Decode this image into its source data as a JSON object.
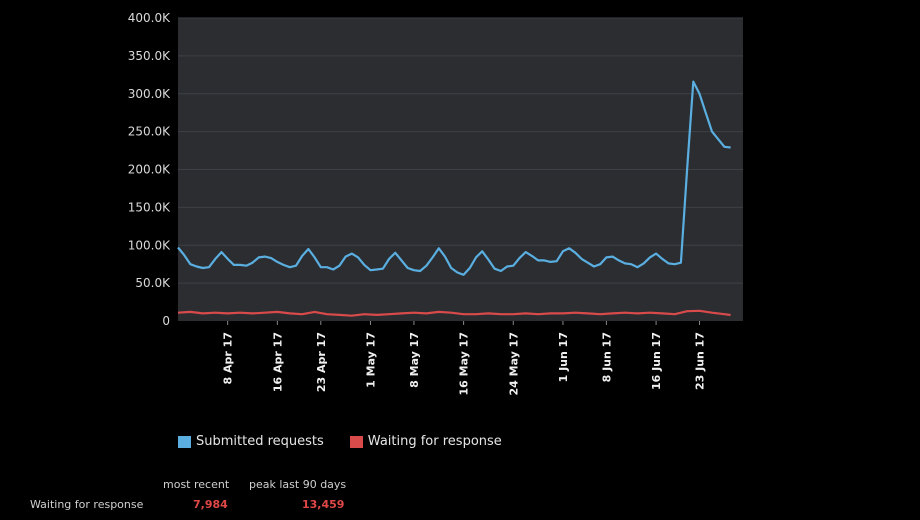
{
  "chart_data": {
    "type": "line",
    "ylim": [
      0,
      400000
    ],
    "y_ticks": [
      {
        "value": 0,
        "label": "0"
      },
      {
        "value": 50000,
        "label": "50.0K"
      },
      {
        "value": 100000,
        "label": "100.0K"
      },
      {
        "value": 150000,
        "label": "150.0K"
      },
      {
        "value": 200000,
        "label": "200.0K"
      },
      {
        "value": 250000,
        "label": "250.0K"
      },
      {
        "value": 300000,
        "label": "300.0K"
      },
      {
        "value": 350000,
        "label": "350.0K"
      },
      {
        "value": 400000,
        "label": "400.0K"
      }
    ],
    "x_range": [
      "2017-03-31",
      "2017-06-30"
    ],
    "x_ticks": [
      {
        "date": "2017-04-08",
        "label": "8 Apr 17"
      },
      {
        "date": "2017-04-16",
        "label": "16 Apr 17"
      },
      {
        "date": "2017-04-23",
        "label": "23 Apr 17"
      },
      {
        "date": "2017-05-01",
        "label": "1 May 17"
      },
      {
        "date": "2017-05-08",
        "label": "8 May 17"
      },
      {
        "date": "2017-05-16",
        "label": "16 May 17"
      },
      {
        "date": "2017-05-24",
        "label": "24 May 17"
      },
      {
        "date": "2017-06-01",
        "label": "1 Jun 17"
      },
      {
        "date": "2017-06-08",
        "label": "8 Jun 17"
      },
      {
        "date": "2017-06-16",
        "label": "16 Jun 17"
      },
      {
        "date": "2017-06-23",
        "label": "23 Jun 17"
      }
    ],
    "grid": true,
    "legend_position": "bottom-left",
    "series": [
      {
        "name": "Submitted requests",
        "color": "#5aaee0",
        "points": [
          [
            "2017-03-31",
            97000
          ],
          [
            "2017-04-01",
            87000
          ],
          [
            "2017-04-02",
            75000
          ],
          [
            "2017-04-03",
            72000
          ],
          [
            "2017-04-04",
            70000
          ],
          [
            "2017-04-05",
            71000
          ],
          [
            "2017-04-06",
            82000
          ],
          [
            "2017-04-07",
            91000
          ],
          [
            "2017-04-08",
            82000
          ],
          [
            "2017-04-09",
            74000
          ],
          [
            "2017-04-10",
            74000
          ],
          [
            "2017-04-11",
            73000
          ],
          [
            "2017-04-12",
            77000
          ],
          [
            "2017-04-13",
            84000
          ],
          [
            "2017-04-14",
            85000
          ],
          [
            "2017-04-15",
            83000
          ],
          [
            "2017-04-16",
            78000
          ],
          [
            "2017-04-17",
            74000
          ],
          [
            "2017-04-18",
            71000
          ],
          [
            "2017-04-19",
            73000
          ],
          [
            "2017-04-20",
            86000
          ],
          [
            "2017-04-21",
            95000
          ],
          [
            "2017-04-22",
            84000
          ],
          [
            "2017-04-23",
            71000
          ],
          [
            "2017-04-24",
            71000
          ],
          [
            "2017-04-25",
            68000
          ],
          [
            "2017-04-26",
            73000
          ],
          [
            "2017-04-27",
            85000
          ],
          [
            "2017-04-28",
            89000
          ],
          [
            "2017-04-29",
            84000
          ],
          [
            "2017-04-30",
            74000
          ],
          [
            "2017-05-01",
            67000
          ],
          [
            "2017-05-02",
            68000
          ],
          [
            "2017-05-03",
            69000
          ],
          [
            "2017-05-04",
            82000
          ],
          [
            "2017-05-05",
            90000
          ],
          [
            "2017-05-06",
            80000
          ],
          [
            "2017-05-07",
            70000
          ],
          [
            "2017-05-08",
            67000
          ],
          [
            "2017-05-09",
            66000
          ],
          [
            "2017-05-10",
            73000
          ],
          [
            "2017-05-11",
            84000
          ],
          [
            "2017-05-12",
            96000
          ],
          [
            "2017-05-13",
            85000
          ],
          [
            "2017-05-14",
            70000
          ],
          [
            "2017-05-15",
            64000
          ],
          [
            "2017-05-16",
            61000
          ],
          [
            "2017-05-17",
            70000
          ],
          [
            "2017-05-18",
            84000
          ],
          [
            "2017-05-19",
            92000
          ],
          [
            "2017-05-20",
            81000
          ],
          [
            "2017-05-21",
            69000
          ],
          [
            "2017-05-22",
            66000
          ],
          [
            "2017-05-23",
            72000
          ],
          [
            "2017-05-24",
            73000
          ],
          [
            "2017-05-25",
            83000
          ],
          [
            "2017-05-26",
            91000
          ],
          [
            "2017-05-27",
            86000
          ],
          [
            "2017-05-28",
            80000
          ],
          [
            "2017-05-29",
            80000
          ],
          [
            "2017-05-30",
            78000
          ],
          [
            "2017-05-31",
            79000
          ],
          [
            "2017-06-01",
            92000
          ],
          [
            "2017-06-02",
            96000
          ],
          [
            "2017-06-03",
            90000
          ],
          [
            "2017-06-04",
            82000
          ],
          [
            "2017-06-05",
            77000
          ],
          [
            "2017-06-06",
            72000
          ],
          [
            "2017-06-07",
            75000
          ],
          [
            "2017-06-08",
            84000
          ],
          [
            "2017-06-09",
            85000
          ],
          [
            "2017-06-10",
            80000
          ],
          [
            "2017-06-11",
            76000
          ],
          [
            "2017-06-12",
            75000
          ],
          [
            "2017-06-13",
            71000
          ],
          [
            "2017-06-14",
            76000
          ],
          [
            "2017-06-15",
            84000
          ],
          [
            "2017-06-16",
            89000
          ],
          [
            "2017-06-17",
            82000
          ],
          [
            "2017-06-18",
            76000
          ],
          [
            "2017-06-19",
            75000
          ],
          [
            "2017-06-20",
            77000
          ],
          [
            "2017-06-21",
            200000
          ],
          [
            "2017-06-22",
            316000
          ],
          [
            "2017-06-23",
            300000
          ],
          [
            "2017-06-24",
            275000
          ],
          [
            "2017-06-25",
            250000
          ],
          [
            "2017-06-26",
            240000
          ],
          [
            "2017-06-27",
            230000
          ],
          [
            "2017-06-28",
            229000
          ]
        ]
      },
      {
        "name": "Waiting for response",
        "color": "#d94a4a",
        "points": [
          [
            "2017-03-31",
            11000
          ],
          [
            "2017-04-02",
            12000
          ],
          [
            "2017-04-04",
            10000
          ],
          [
            "2017-04-06",
            11000
          ],
          [
            "2017-04-08",
            10000
          ],
          [
            "2017-04-10",
            11000
          ],
          [
            "2017-04-12",
            10000
          ],
          [
            "2017-04-14",
            11000
          ],
          [
            "2017-04-16",
            12000
          ],
          [
            "2017-04-18",
            10000
          ],
          [
            "2017-04-20",
            9000
          ],
          [
            "2017-04-22",
            12000
          ],
          [
            "2017-04-24",
            9000
          ],
          [
            "2017-04-26",
            8000
          ],
          [
            "2017-04-28",
            7000
          ],
          [
            "2017-04-30",
            9000
          ],
          [
            "2017-05-02",
            8000
          ],
          [
            "2017-05-04",
            9000
          ],
          [
            "2017-05-06",
            10000
          ],
          [
            "2017-05-08",
            11000
          ],
          [
            "2017-05-10",
            10000
          ],
          [
            "2017-05-12",
            12000
          ],
          [
            "2017-05-14",
            11000
          ],
          [
            "2017-05-16",
            9000
          ],
          [
            "2017-05-18",
            9000
          ],
          [
            "2017-05-20",
            10000
          ],
          [
            "2017-05-22",
            9000
          ],
          [
            "2017-05-24",
            9000
          ],
          [
            "2017-05-26",
            10000
          ],
          [
            "2017-05-28",
            9000
          ],
          [
            "2017-05-30",
            10000
          ],
          [
            "2017-06-01",
            10000
          ],
          [
            "2017-06-03",
            11000
          ],
          [
            "2017-06-05",
            10000
          ],
          [
            "2017-06-07",
            9000
          ],
          [
            "2017-06-09",
            10000
          ],
          [
            "2017-06-11",
            11000
          ],
          [
            "2017-06-13",
            10000
          ],
          [
            "2017-06-15",
            11000
          ],
          [
            "2017-06-17",
            10000
          ],
          [
            "2017-06-19",
            9000
          ],
          [
            "2017-06-21",
            13000
          ],
          [
            "2017-06-23",
            13459
          ],
          [
            "2017-06-25",
            11000
          ],
          [
            "2017-06-27",
            9000
          ],
          [
            "2017-06-28",
            7984
          ]
        ]
      }
    ]
  },
  "summary": {
    "col_recent": "most recent",
    "col_peak": "peak last 90 days",
    "row_label": "Waiting for response",
    "recent_value": "7,984",
    "peak_value": "13,459"
  },
  "colors": {
    "plot_bg": "#2b2d31",
    "grid": "#3d4046",
    "value_red": "#e04848"
  }
}
